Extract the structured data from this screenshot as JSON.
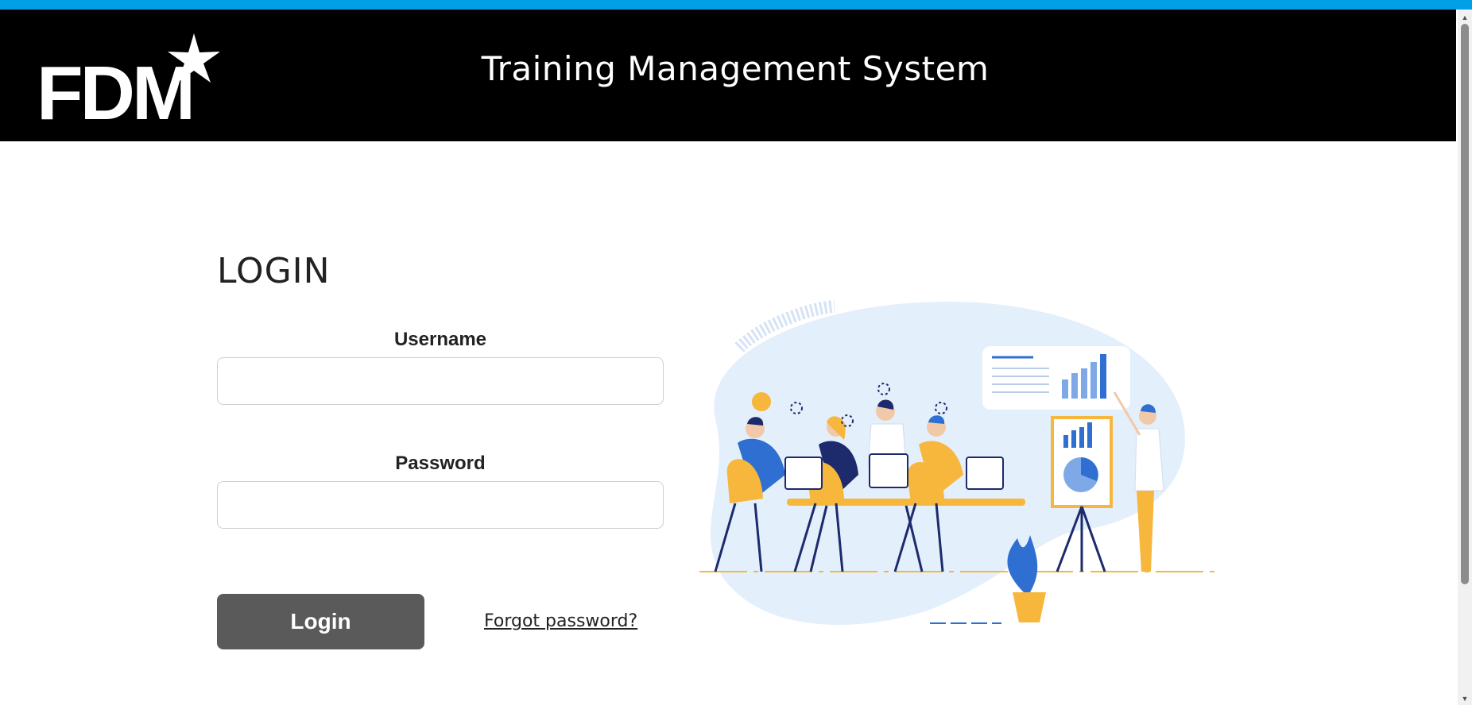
{
  "header": {
    "brand": "FDM",
    "title": "Training Management System"
  },
  "login": {
    "title": "LOGIN",
    "username_label": "Username",
    "username_value": "",
    "password_label": "Password",
    "password_value": "",
    "login_button": "Login",
    "forgot_link": "Forgot password?"
  },
  "colors": {
    "accent_strip": "#009fe8",
    "header_bg": "#000000",
    "button_bg": "#5a5a5a",
    "illustration_blue": "#2e6fd1",
    "illustration_yellow": "#f6b73c"
  },
  "icons": {
    "scroll_up": "▲",
    "scroll_down": "▼"
  }
}
